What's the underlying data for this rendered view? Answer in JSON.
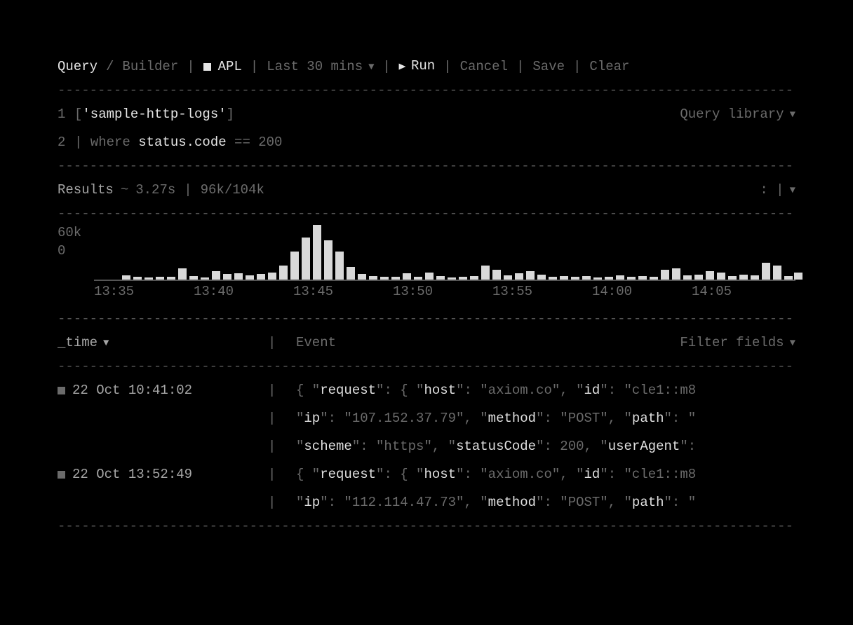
{
  "toolbar": {
    "query_label": "Query",
    "slash": "/",
    "builder_label": "Builder",
    "apl_label": "APL",
    "timerange_label": "Last 30 mins",
    "run_label": "Run",
    "cancel_label": "Cancel",
    "save_label": "Save",
    "clear_label": "Clear"
  },
  "editor": {
    "query_library_label": "Query library",
    "lines": [
      {
        "n": "1",
        "pre": "[",
        "highlight": "'sample-http-logs'",
        "post": "]"
      },
      {
        "n": "2",
        "pre": "| where ",
        "highlight": "status.code",
        "post": " == 200"
      }
    ]
  },
  "results": {
    "label": "Results",
    "tilde": "~",
    "duration": "3.27s",
    "count": "96k/104k",
    "icon_row": ": |"
  },
  "chart_data": {
    "type": "bar",
    "ylabels": [
      "60k",
      "0"
    ],
    "ylim_max": 80000,
    "x_ticks": [
      "13:35",
      "13:40",
      "13:45",
      "13:50",
      "13:55",
      "14:00",
      "14:05"
    ],
    "x_tick_positions_pct": [
      3,
      19,
      34,
      49,
      64,
      79,
      94
    ],
    "bars": [
      {
        "pos_pct": 4.0,
        "value": 6000
      },
      {
        "pos_pct": 5.6,
        "value": 4000
      },
      {
        "pos_pct": 7.2,
        "value": 3000
      },
      {
        "pos_pct": 8.8,
        "value": 4500
      },
      {
        "pos_pct": 10.4,
        "value": 4000
      },
      {
        "pos_pct": 12.0,
        "value": 16000
      },
      {
        "pos_pct": 13.6,
        "value": 5000
      },
      {
        "pos_pct": 15.2,
        "value": 3500
      },
      {
        "pos_pct": 16.8,
        "value": 12000
      },
      {
        "pos_pct": 18.4,
        "value": 8000
      },
      {
        "pos_pct": 20.0,
        "value": 9000
      },
      {
        "pos_pct": 21.6,
        "value": 6000
      },
      {
        "pos_pct": 23.2,
        "value": 8000
      },
      {
        "pos_pct": 24.8,
        "value": 10000
      },
      {
        "pos_pct": 26.4,
        "value": 20000
      },
      {
        "pos_pct": 28.0,
        "value": 40000
      },
      {
        "pos_pct": 29.6,
        "value": 60000
      },
      {
        "pos_pct": 31.2,
        "value": 78000
      },
      {
        "pos_pct": 32.8,
        "value": 56000
      },
      {
        "pos_pct": 34.4,
        "value": 40000
      },
      {
        "pos_pct": 36.0,
        "value": 18000
      },
      {
        "pos_pct": 37.6,
        "value": 8000
      },
      {
        "pos_pct": 39.2,
        "value": 5000
      },
      {
        "pos_pct": 40.8,
        "value": 4000
      },
      {
        "pos_pct": 42.4,
        "value": 4000
      },
      {
        "pos_pct": 44.0,
        "value": 9000
      },
      {
        "pos_pct": 45.6,
        "value": 4500
      },
      {
        "pos_pct": 47.2,
        "value": 10000
      },
      {
        "pos_pct": 48.8,
        "value": 5000
      },
      {
        "pos_pct": 50.4,
        "value": 3500
      },
      {
        "pos_pct": 52.0,
        "value": 4000
      },
      {
        "pos_pct": 53.6,
        "value": 5500
      },
      {
        "pos_pct": 55.2,
        "value": 20000
      },
      {
        "pos_pct": 56.8,
        "value": 14000
      },
      {
        "pos_pct": 58.4,
        "value": 6000
      },
      {
        "pos_pct": 60.0,
        "value": 9000
      },
      {
        "pos_pct": 61.6,
        "value": 12000
      },
      {
        "pos_pct": 63.2,
        "value": 7000
      },
      {
        "pos_pct": 64.8,
        "value": 4000
      },
      {
        "pos_pct": 66.4,
        "value": 5000
      },
      {
        "pos_pct": 68.0,
        "value": 4000
      },
      {
        "pos_pct": 69.6,
        "value": 5500
      },
      {
        "pos_pct": 71.2,
        "value": 3500
      },
      {
        "pos_pct": 72.8,
        "value": 4000
      },
      {
        "pos_pct": 74.4,
        "value": 6000
      },
      {
        "pos_pct": 76.0,
        "value": 4500
      },
      {
        "pos_pct": 77.6,
        "value": 5000
      },
      {
        "pos_pct": 79.2,
        "value": 4000
      },
      {
        "pos_pct": 80.8,
        "value": 14000
      },
      {
        "pos_pct": 82.4,
        "value": 16000
      },
      {
        "pos_pct": 84.0,
        "value": 6000
      },
      {
        "pos_pct": 85.6,
        "value": 7000
      },
      {
        "pos_pct": 87.2,
        "value": 12000
      },
      {
        "pos_pct": 88.8,
        "value": 10000
      },
      {
        "pos_pct": 90.4,
        "value": 5000
      },
      {
        "pos_pct": 92.0,
        "value": 7000
      },
      {
        "pos_pct": 93.6,
        "value": 6000
      },
      {
        "pos_pct": 95.2,
        "value": 24000
      },
      {
        "pos_pct": 96.8,
        "value": 20000
      },
      {
        "pos_pct": 98.4,
        "value": 5000
      },
      {
        "pos_pct": 99.8,
        "value": 10000
      }
    ]
  },
  "table": {
    "col_time": "_time",
    "col_event": "Event",
    "filter_fields": "Filter fields",
    "rows": [
      {
        "time": "22 Oct 10:41:02",
        "lines": [
          [
            {
              "t": "{ \"",
              "k": false
            },
            {
              "t": "request",
              "k": true
            },
            {
              "t": "\": { \"",
              "k": false
            },
            {
              "t": "host",
              "k": true
            },
            {
              "t": "\": \"axiom.co\", \"",
              "k": false
            },
            {
              "t": "id",
              "k": true
            },
            {
              "t": "\": \"cle1::m8",
              "k": false
            }
          ],
          [
            {
              "t": "\"",
              "k": false
            },
            {
              "t": "ip",
              "k": true
            },
            {
              "t": "\": \"107.152.37.79\", \"",
              "k": false
            },
            {
              "t": "method",
              "k": true
            },
            {
              "t": "\": \"POST\", \"",
              "k": false
            },
            {
              "t": "path",
              "k": true
            },
            {
              "t": "\": \"",
              "k": false
            }
          ],
          [
            {
              "t": "\"",
              "k": false
            },
            {
              "t": "scheme",
              "k": true
            },
            {
              "t": "\": \"https\", \"",
              "k": false
            },
            {
              "t": "statusCode",
              "k": true
            },
            {
              "t": "\": 200, \"",
              "k": false
            },
            {
              "t": "userAgent",
              "k": true
            },
            {
              "t": "\":",
              "k": false
            }
          ]
        ]
      },
      {
        "time": "22 Oct 13:52:49",
        "lines": [
          [
            {
              "t": "{ \"",
              "k": false
            },
            {
              "t": "request",
              "k": true
            },
            {
              "t": "\": { \"",
              "k": false
            },
            {
              "t": "host",
              "k": true
            },
            {
              "t": "\": \"axiom.co\", \"",
              "k": false
            },
            {
              "t": "id",
              "k": true
            },
            {
              "t": "\": \"cle1::m8",
              "k": false
            }
          ],
          [
            {
              "t": "\"",
              "k": false
            },
            {
              "t": "ip",
              "k": true
            },
            {
              "t": "\": \"112.114.47.73\", \"",
              "k": false
            },
            {
              "t": "method",
              "k": true
            },
            {
              "t": "\": \"POST\", \"",
              "k": false
            },
            {
              "t": "path",
              "k": true
            },
            {
              "t": "\": \"",
              "k": false
            }
          ]
        ]
      }
    ]
  }
}
